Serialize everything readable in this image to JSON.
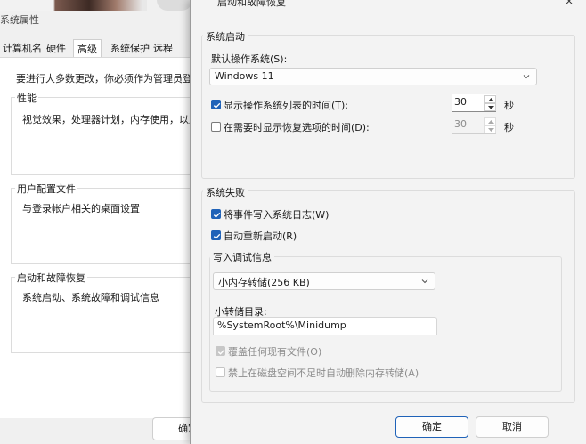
{
  "background_dialog": {
    "title": "系统属性",
    "tabs": [
      "计算机名",
      "硬件",
      "高级",
      "系统保护",
      "远程"
    ],
    "note": "要进行大多数更改，你必须作为管理员登录",
    "groups": [
      {
        "title": "性能",
        "content": "视觉效果，处理器计划，内存使用，以及"
      },
      {
        "title": "用户配置文件",
        "content": "与登录帐户相关的桌面设置"
      },
      {
        "title": "启动和故障恢复",
        "content": "系统启动、系统故障和调试信息"
      }
    ],
    "ok_label": "确定"
  },
  "dialog": {
    "title": "启动和故障恢复",
    "close_icon": "×",
    "system_startup": {
      "title": "系统启动",
      "default_os_label": "默认操作系统(S):",
      "default_os_value": "Windows 11",
      "show_list": {
        "label": "显示操作系统列表的时间(T):",
        "checked": true,
        "value": "30",
        "unit": "秒"
      },
      "show_recovery": {
        "label": "在需要时显示恢复选项的时间(D):",
        "checked": false,
        "value": "30",
        "unit": "秒"
      }
    },
    "system_failure": {
      "title": "系统失败",
      "write_event": {
        "label": "将事件写入系统日志(W)",
        "checked": true
      },
      "auto_restart": {
        "label": "自动重新启动(R)",
        "checked": true
      },
      "debug_info": {
        "title": "写入调试信息",
        "dump_type": "小内存转储(256 KB)",
        "dump_dir_label": "小转储目录:",
        "dump_dir_value": "%SystemRoot%\\Minidump",
        "overwrite": {
          "label": "覆盖任何现有文件(O)",
          "checked": true,
          "disabled": true
        },
        "disable_auto_delete": {
          "label": "禁止在磁盘空间不足时自动删除内存转储(A)",
          "checked": false,
          "disabled": true
        }
      }
    },
    "ok_label": "确定",
    "cancel_label": "取消"
  },
  "colors": {
    "accent": "#1f62b8",
    "window_bg": "#f3f3f3"
  }
}
